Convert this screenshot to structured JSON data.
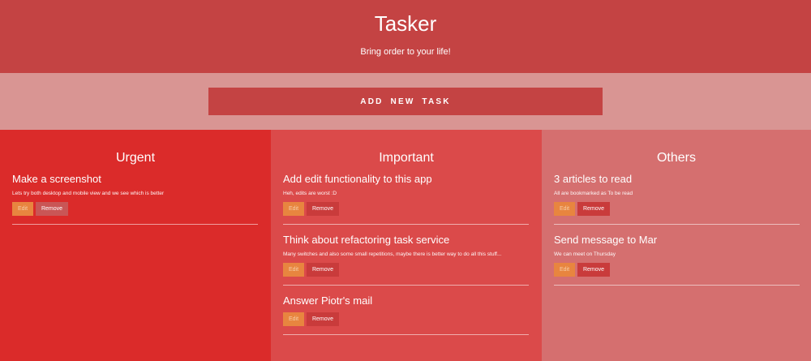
{
  "app": {
    "title": "Tasker",
    "tagline": "Bring order to your life!"
  },
  "toolbar": {
    "add_label": "ADD NEW TASK"
  },
  "labels": {
    "edit": "Edit",
    "remove": "Remove"
  },
  "columns": [
    {
      "title": "Urgent",
      "tasks": [
        {
          "title": "Make a screenshot",
          "description": "Lets try both desktop and mobile view and we see which is better"
        }
      ]
    },
    {
      "title": "Important",
      "tasks": [
        {
          "title": "Add edit functionality to this app",
          "description": "Heh, edits are worst :D"
        },
        {
          "title": "Think about refactoring task service",
          "description": "Many switches and also some small repetitions, maybe there is better way to do all this stuff..."
        },
        {
          "title": "Answer Piotr's mail",
          "description": ""
        }
      ]
    },
    {
      "title": "Others",
      "tasks": [
        {
          "title": "3 articles to read",
          "description": "All are bookmarked as To be read"
        },
        {
          "title": "Send message to Mar",
          "description": "We can meet on Thursday"
        }
      ]
    }
  ],
  "colors": {
    "header": "#c44343",
    "add_bar": "#d99593",
    "urgent": "#db2b2a",
    "important": "#db4a4a",
    "others": "#d56f6f",
    "edit": "#e8853f"
  }
}
